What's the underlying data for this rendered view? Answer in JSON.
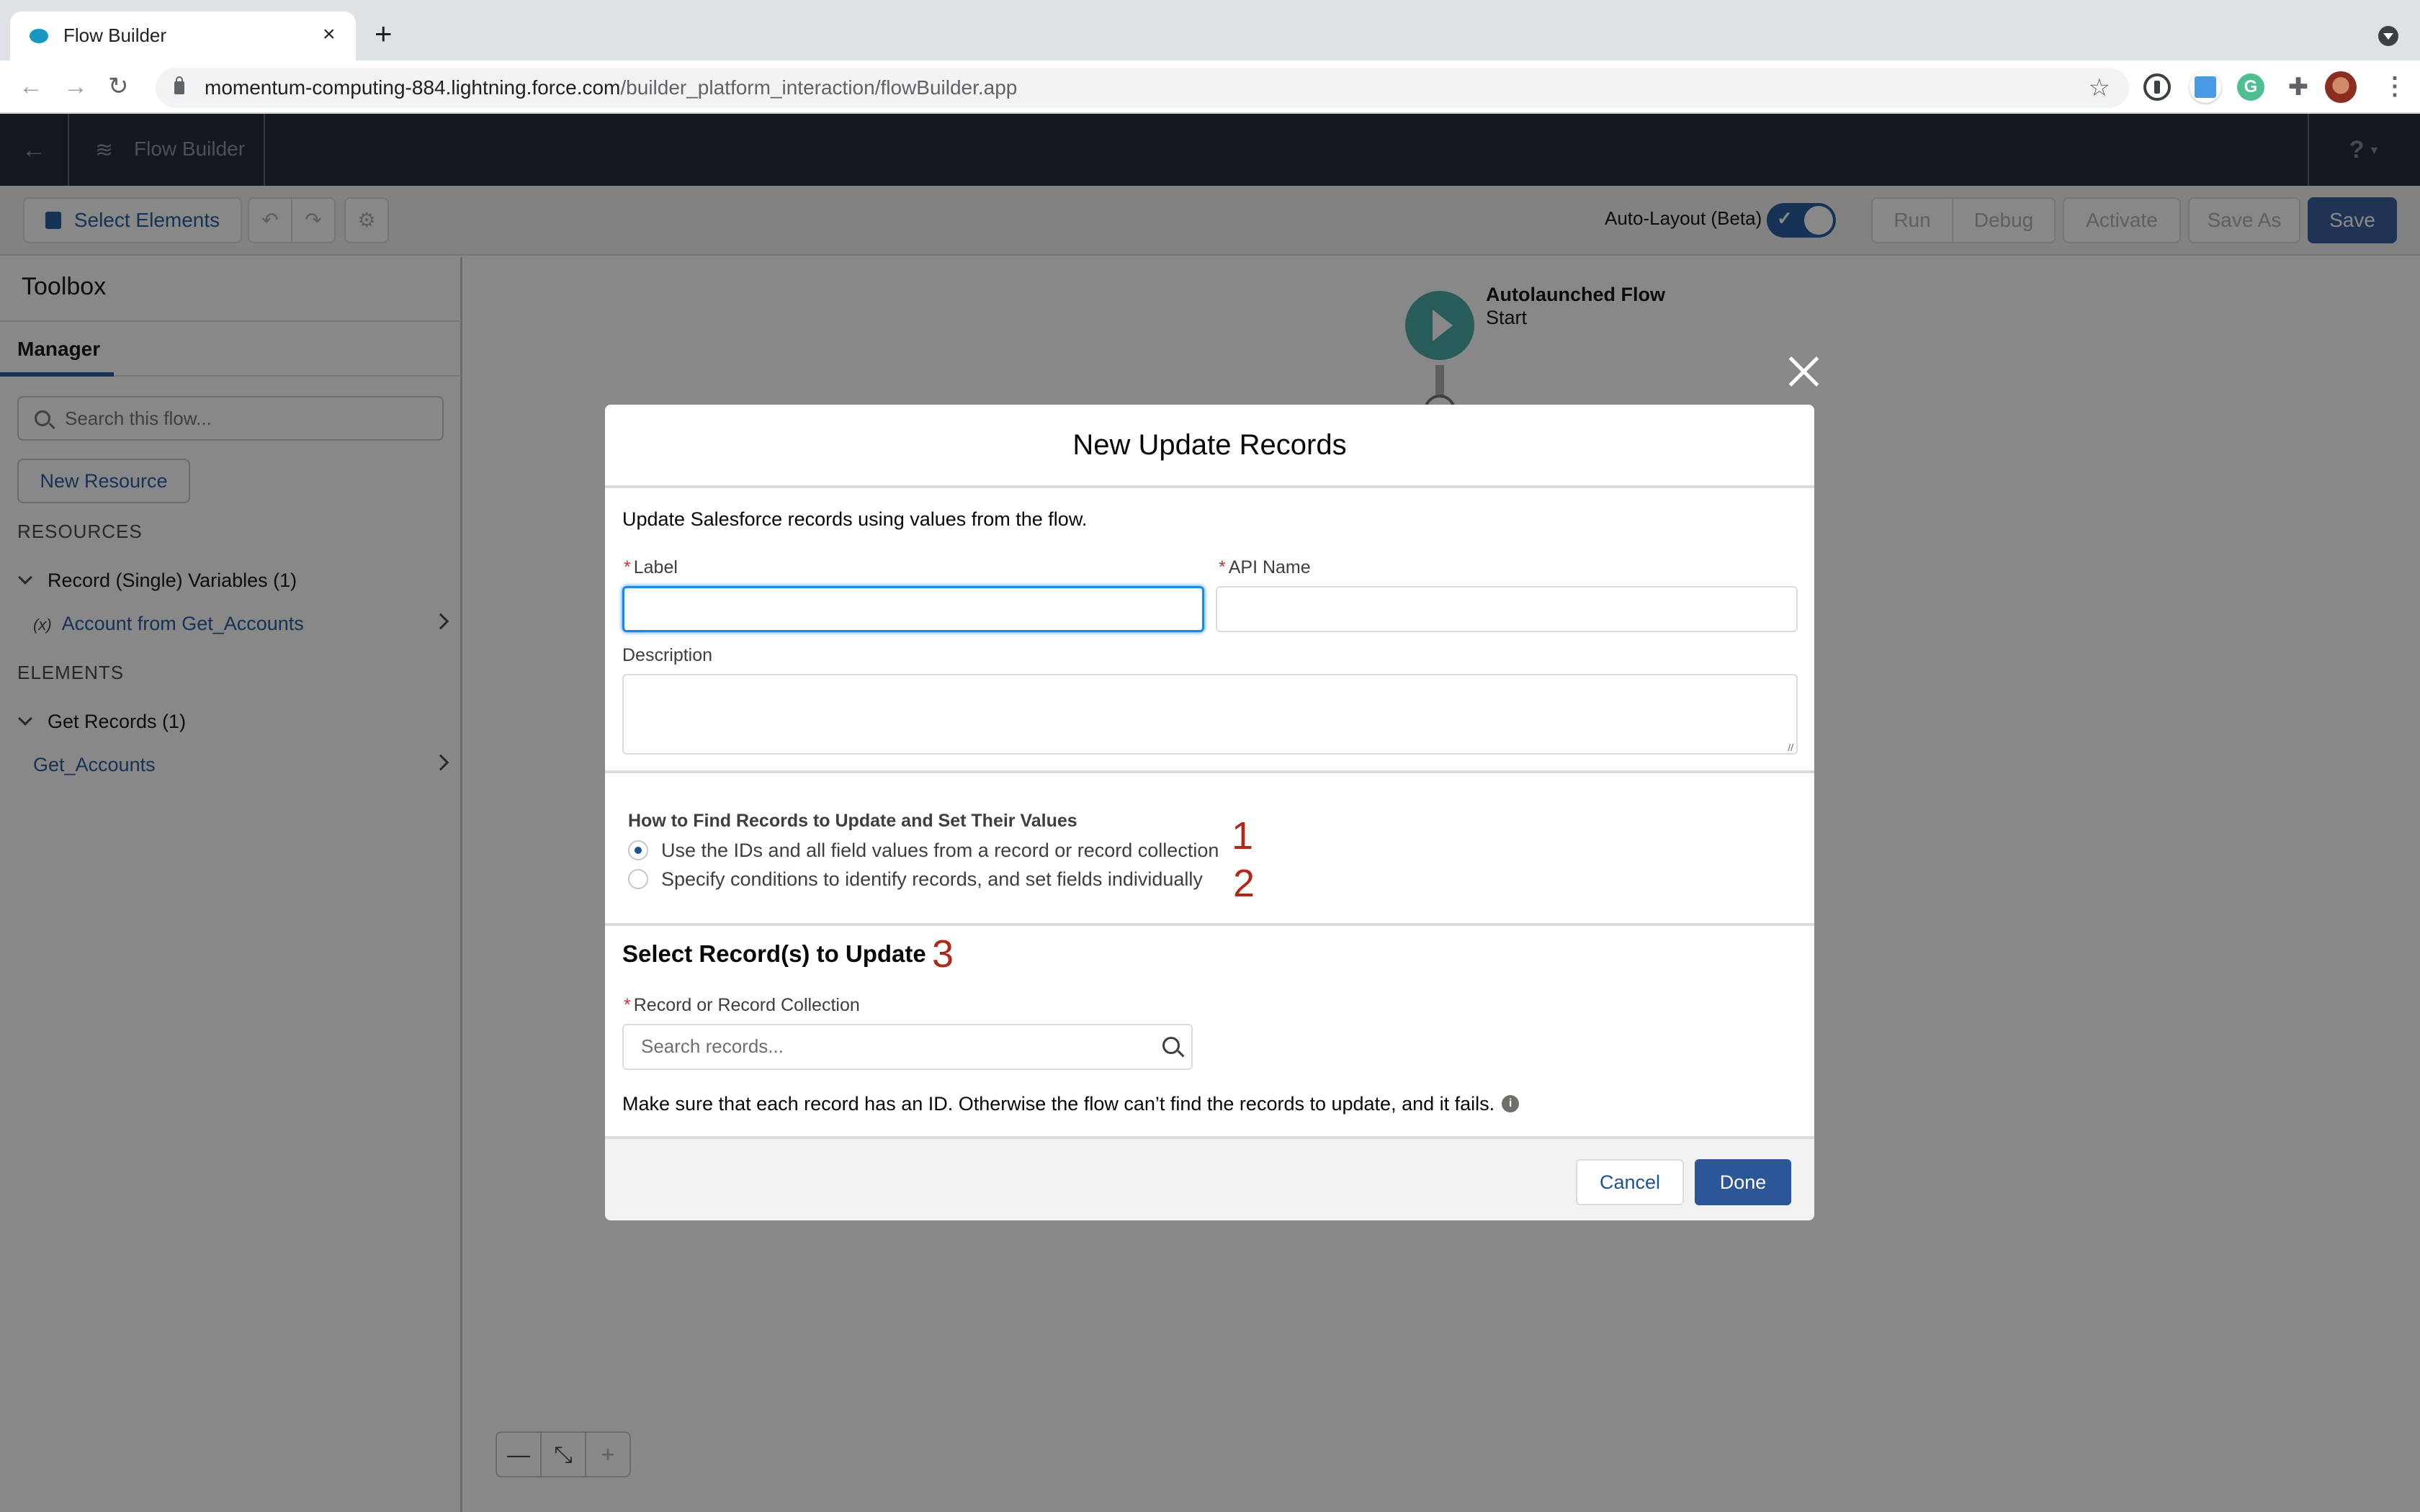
{
  "browser": {
    "tab_title": "Flow Builder",
    "tab_close": "×",
    "new_tab": "+",
    "url_host": "momentum-computing-884.lightning.force.com",
    "url_path": "/builder_platform_interaction/flowBuilder.app",
    "icons": {
      "back": "←",
      "forward": "→",
      "reload": "↻",
      "star": "☆",
      "puzzle": "✚",
      "kebab": "⋮",
      "grammarly": "G"
    }
  },
  "app_header": {
    "back_icon": "←",
    "logo_icon": "≋",
    "title": "Flow Builder",
    "help_icon": "?",
    "help_caret": "▼"
  },
  "toolbar": {
    "select_elements": "Select Elements",
    "undo_icon": "↶",
    "redo_icon": "↷",
    "gear_icon": "⚙",
    "auto_layout_label": "Auto-Layout (Beta)",
    "auto_layout_on": true,
    "toggle_check": "✓",
    "run": "Run",
    "debug": "Debug",
    "activate": "Activate",
    "save_as": "Save As",
    "save": "Save"
  },
  "sidebar": {
    "title": "Toolbox",
    "tab": "Manager",
    "search_placeholder": "Search this flow...",
    "new_resource": "New Resource",
    "resources_heading": "RESOURCES",
    "resource_groups": [
      {
        "label": "Record (Single) Variables (1)",
        "items": [
          {
            "icon": "(x)",
            "label": "Account from Get_Accounts"
          }
        ]
      }
    ],
    "elements_heading": "ELEMENTS",
    "element_groups": [
      {
        "label": "Get Records (1)",
        "items": [
          {
            "label": "Get_Accounts"
          }
        ]
      }
    ]
  },
  "canvas": {
    "start_title": "Autolaunched Flow",
    "start_subtitle": "Start",
    "zoom_out": "—",
    "fit": "⤡",
    "zoom_in": "+"
  },
  "modal": {
    "title": "New Update Records",
    "description": "Update Salesforce records using values from the flow.",
    "required_marker": "*",
    "label_field": {
      "label": "Label",
      "value": ""
    },
    "api_name_field": {
      "label": "API Name",
      "value": ""
    },
    "description_field": {
      "label": "Description",
      "value": ""
    },
    "how_to_find": {
      "heading": "How to Find Records to Update and Set Their Values",
      "options": [
        {
          "label": "Use the IDs and all field values from a record or record collection",
          "selected": true
        },
        {
          "label": "Specify conditions to identify records, and set fields individually",
          "selected": false
        }
      ]
    },
    "select_records": {
      "heading": "Select Record(s) to Update",
      "field_label": "Record or Record Collection",
      "placeholder": "Search records..."
    },
    "warning": "Make sure that each record has an ID. Otherwise the flow can’t find the records to update, and it fails.",
    "info_icon": "i",
    "cancel": "Cancel",
    "done": "Done",
    "close_icon": "×"
  },
  "annotations": [
    "1",
    "2",
    "3"
  ],
  "colors": {
    "brand_blue": "#1b5297",
    "primary_button": "#2c5697",
    "header_navy": "#141e31",
    "required_red": "#c23934",
    "annotation_red": "#b0281a",
    "start_node": "#3ea6a0"
  }
}
